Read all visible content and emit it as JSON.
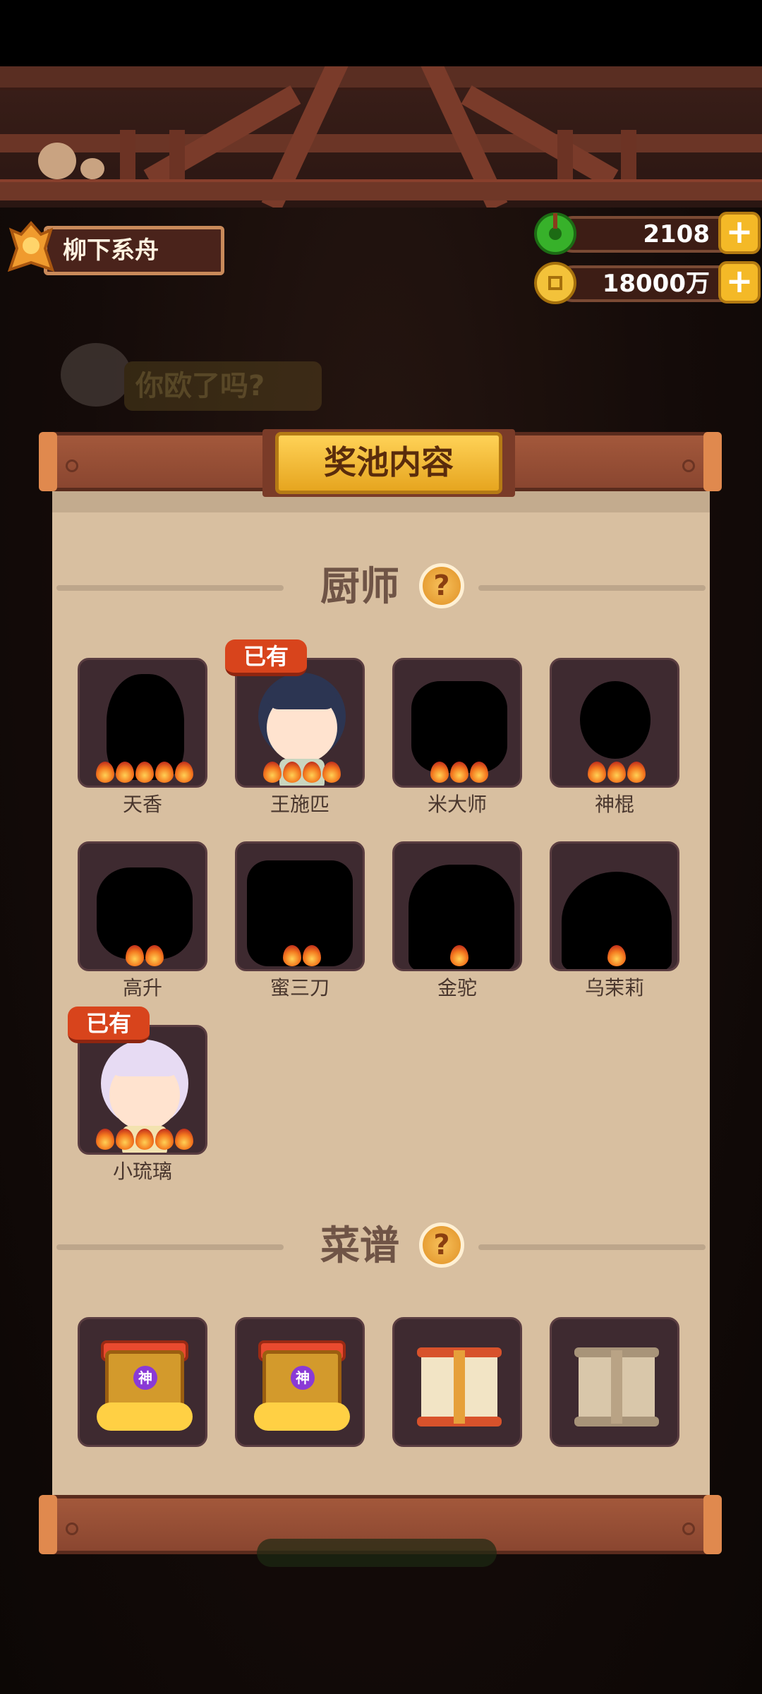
{
  "player": {
    "name": "柳下系舟"
  },
  "currencies": {
    "jade": {
      "value": "2108",
      "plus": "+"
    },
    "coins": {
      "value": "18000万",
      "plus": "+"
    }
  },
  "hint": {
    "text": "你欧了吗?"
  },
  "panel": {
    "title": "奖池内容"
  },
  "sections": {
    "chefs": {
      "title": "厨师",
      "help": "?"
    },
    "recipes": {
      "title": "菜谱",
      "help": "?"
    }
  },
  "owned_label": "已有",
  "chefs": [
    {
      "name": "天香",
      "stars": 5,
      "owned": false
    },
    {
      "name": "王施匹",
      "stars": 4,
      "owned": true
    },
    {
      "name": "米大师",
      "stars": 3,
      "owned": false
    },
    {
      "name": "神棍",
      "stars": 3,
      "owned": false
    },
    {
      "name": "高升",
      "stars": 2,
      "owned": false
    },
    {
      "name": "蜜三刀",
      "stars": 2,
      "owned": false
    },
    {
      "name": "金驼",
      "stars": 1,
      "owned": false
    },
    {
      "name": "乌茉莉",
      "stars": 1,
      "owned": false
    },
    {
      "name": "小琉璃",
      "stars": 5,
      "owned": true
    }
  ],
  "recipes": [
    {
      "kind": "god-chest",
      "badge": "神"
    },
    {
      "kind": "god-chest",
      "badge": "神"
    },
    {
      "kind": "red-scroll",
      "badge": ""
    },
    {
      "kind": "plain-scroll",
      "badge": ""
    }
  ],
  "colors": {
    "panel_bg": "#d8bfa0",
    "card_bg": "#3e2a30",
    "owned_badge": "#d8441c",
    "title_plate": "#f2bb2e",
    "plank": "#9a5035"
  }
}
